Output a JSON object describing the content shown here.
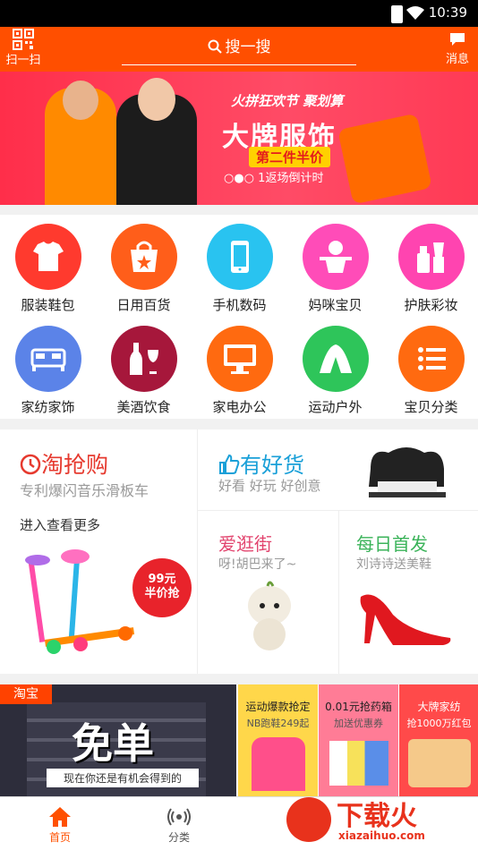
{
  "status_bar": {
    "time": "10:39"
  },
  "header": {
    "scan_label": "扫一扫",
    "search_label": "搜一搜",
    "message_label": "消息"
  },
  "banner": {
    "tag": "火拼狂欢节 聚划算",
    "title": "大牌服饰",
    "subtitle": "第二件半价",
    "countdown": "1返场倒计时"
  },
  "categories": [
    {
      "label": "服装鞋包",
      "color": "#ff3a2e",
      "icon": "tshirt-icon"
    },
    {
      "label": "日用百货",
      "color": "#ff5e1a",
      "icon": "shopping-bag-icon"
    },
    {
      "label": "手机数码",
      "color": "#29c3f0",
      "icon": "phone-icon"
    },
    {
      "label": "妈咪宝贝",
      "color": "#ff4cb8",
      "icon": "baby-icon"
    },
    {
      "label": "护肤彩妆",
      "color": "#ff44b0",
      "icon": "cosmetics-icon"
    },
    {
      "label": "家纺家饰",
      "color": "#5b83e8",
      "icon": "bed-icon"
    },
    {
      "label": "美酒饮食",
      "color": "#a6173b",
      "icon": "wine-icon"
    },
    {
      "label": "家电办公",
      "color": "#ff6a10",
      "icon": "monitor-icon"
    },
    {
      "label": "运动户外",
      "color": "#2ec55a",
      "icon": "tent-icon"
    },
    {
      "label": "宝贝分类",
      "color": "#ff6a10",
      "icon": "list-icon"
    }
  ],
  "promo": {
    "taoqiang": {
      "title": "淘抢购",
      "subtitle": "专利爆闪音乐滑板车",
      "more": "进入查看更多",
      "price_line1": "99元",
      "price_line2": "半价抢"
    },
    "youhaohuo": {
      "title": "有好货",
      "subtitle": "好看 好玩 好创意"
    },
    "aiguangjie": {
      "title": "爱逛街",
      "subtitle": "呀!胡巴来了~"
    },
    "meirishoufa": {
      "title": "每日首发",
      "subtitle": "刘诗诗送美鞋"
    }
  },
  "bottom_banner": {
    "badge": "淘宝",
    "big": "免单",
    "caption": "现在你还是有机会得到的",
    "boxes": [
      {
        "line1": "运动爆款抢定",
        "line2": "NB跑鞋249起",
        "bg": "#ffd74a"
      },
      {
        "line1": "0.01元抢药箱",
        "line2": "加送优惠券",
        "bg": "#ff7c96"
      },
      {
        "line1": "大牌家纺",
        "line2": "抢1000万红包",
        "bg": "#ff4a4a"
      }
    ]
  },
  "tabbar": {
    "home": "首页",
    "category": "分类"
  },
  "watermark": {
    "cn": "下载火",
    "en": "xiazaihuo.com"
  }
}
